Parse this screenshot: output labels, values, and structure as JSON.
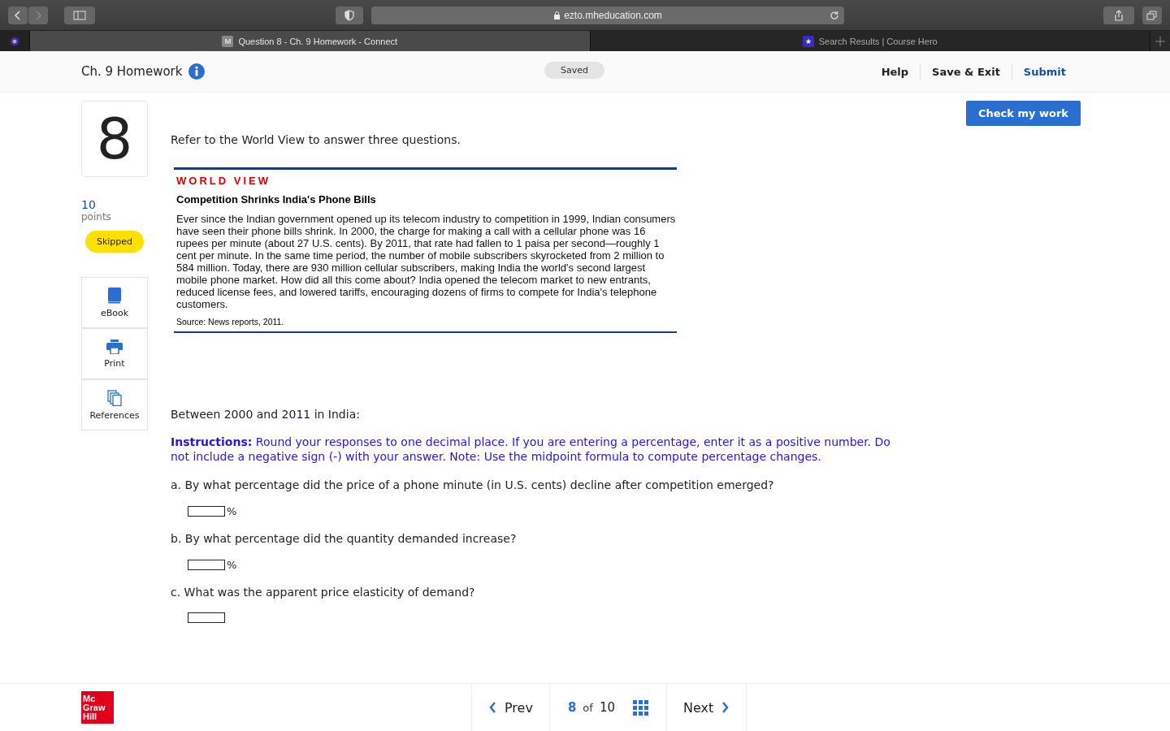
{
  "browser": {
    "address": "ezto.mheducation.com",
    "tabs": [
      {
        "icon": "M",
        "title": "Question 8 - Ch. 9 Homework - Connect",
        "selected": true
      },
      {
        "icon": "★",
        "title": "Search Results | Course Hero",
        "selected": false
      }
    ]
  },
  "header": {
    "title": "Ch. 9 Homework",
    "status": "Saved",
    "links": [
      "Help",
      "Save & Exit",
      "Submit"
    ]
  },
  "check_button": "Check my work",
  "question": {
    "number": "8",
    "points": "10",
    "points_label": "points",
    "status": "Skipped"
  },
  "tools": [
    {
      "kind": "book",
      "label": "eBook"
    },
    {
      "kind": "print",
      "label": "Print"
    },
    {
      "kind": "references",
      "label": "References"
    }
  ],
  "intro": "Refer to the World View to answer three questions.",
  "world_view": {
    "label": "WORLD VIEW",
    "headline": "Competition Shrinks India's Phone Bills",
    "body": "Ever since the Indian government opened up its telecom industry to competition in 1999, Indian consumers have seen their phone bills shrink. In 2000, the charge for making a call with a cellular phone was 16 rupees per minute (about 27 U.S. cents). By 2011, that rate had fallen to 1 paisa per second—roughly 1 cent per minute. In the same time period, the number of mobile subscribers skyrocketed from 2 million to 584 million. Today, there are 930 million cellular subscribers, making India the world's second largest mobile phone market. How did all this come about? India opened the telecom market to new entrants, reduced license fees, and lowered tariffs, encouraging dozens of firms to compete for India's telephone customers.",
    "source": "Source: News reports, 2011."
  },
  "lead": "Between 2000 and 2011 in India:",
  "instructions": "**Instructions:** Round your responses to one decimal place. If you are entering a percentage, enter it as a positive number. Do not include a negative sign (-) with your answer. Note: Use the midpoint formula to compute percentage changes.",
  "parts": [
    {
      "prompt": "a. By what percentage did the price of a phone minute (in U.S. cents) decline after competition emerged?",
      "unit": "%"
    },
    {
      "prompt": "b. By what percentage did the quantity demanded increase?",
      "unit": "%"
    },
    {
      "prompt": "c. What was the apparent price elasticity of demand?"
    }
  ],
  "footer": {
    "logo": [
      "Mc",
      "Graw",
      "Hill"
    ],
    "prev": "Prev",
    "current": "8",
    "of": "of",
    "total": "10",
    "next": "Next"
  }
}
